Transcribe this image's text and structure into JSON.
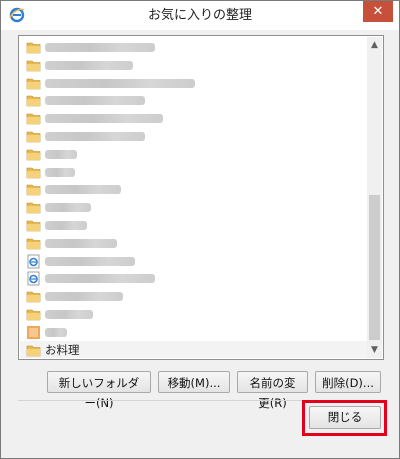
{
  "window": {
    "title": "お気に入りの整理",
    "close_glyph": "✕"
  },
  "favorites": {
    "items": [
      {
        "type": "folder",
        "label": "",
        "blur_width": 110
      },
      {
        "type": "folder",
        "label": "",
        "blur_width": 88
      },
      {
        "type": "folder",
        "label": "",
        "blur_width": 150
      },
      {
        "type": "folder",
        "label": "",
        "blur_width": 100
      },
      {
        "type": "folder",
        "label": "",
        "blur_width": 118
      },
      {
        "type": "folder",
        "label": "",
        "blur_width": 100
      },
      {
        "type": "folder",
        "label": "",
        "blur_width": 32
      },
      {
        "type": "folder",
        "label": "",
        "blur_width": 30
      },
      {
        "type": "folder",
        "label": "",
        "blur_width": 76
      },
      {
        "type": "folder",
        "label": "",
        "blur_width": 46
      },
      {
        "type": "folder",
        "label": "",
        "blur_width": 42
      },
      {
        "type": "folder",
        "label": "",
        "blur_width": 72
      },
      {
        "type": "page",
        "label": "",
        "blur_width": 90
      },
      {
        "type": "page",
        "label": "",
        "blur_width": 110
      },
      {
        "type": "folder",
        "label": "",
        "blur_width": 78
      },
      {
        "type": "folder",
        "label": "",
        "blur_width": 48
      },
      {
        "type": "favicon",
        "label": "",
        "blur_width": 22
      },
      {
        "type": "folder",
        "label": "お料理",
        "blur_width": 0,
        "selected": true
      }
    ]
  },
  "actions": {
    "new_folder": "新しいフォルダー(N)",
    "move": "移動(M)...",
    "rename": "名前の変更(R)",
    "delete": "削除(D)..."
  },
  "footer": {
    "close": "閉じる"
  },
  "colors": {
    "highlight": "#e3001b",
    "folder": "#e8b94a",
    "ie_blue": "#2f7fd6"
  }
}
